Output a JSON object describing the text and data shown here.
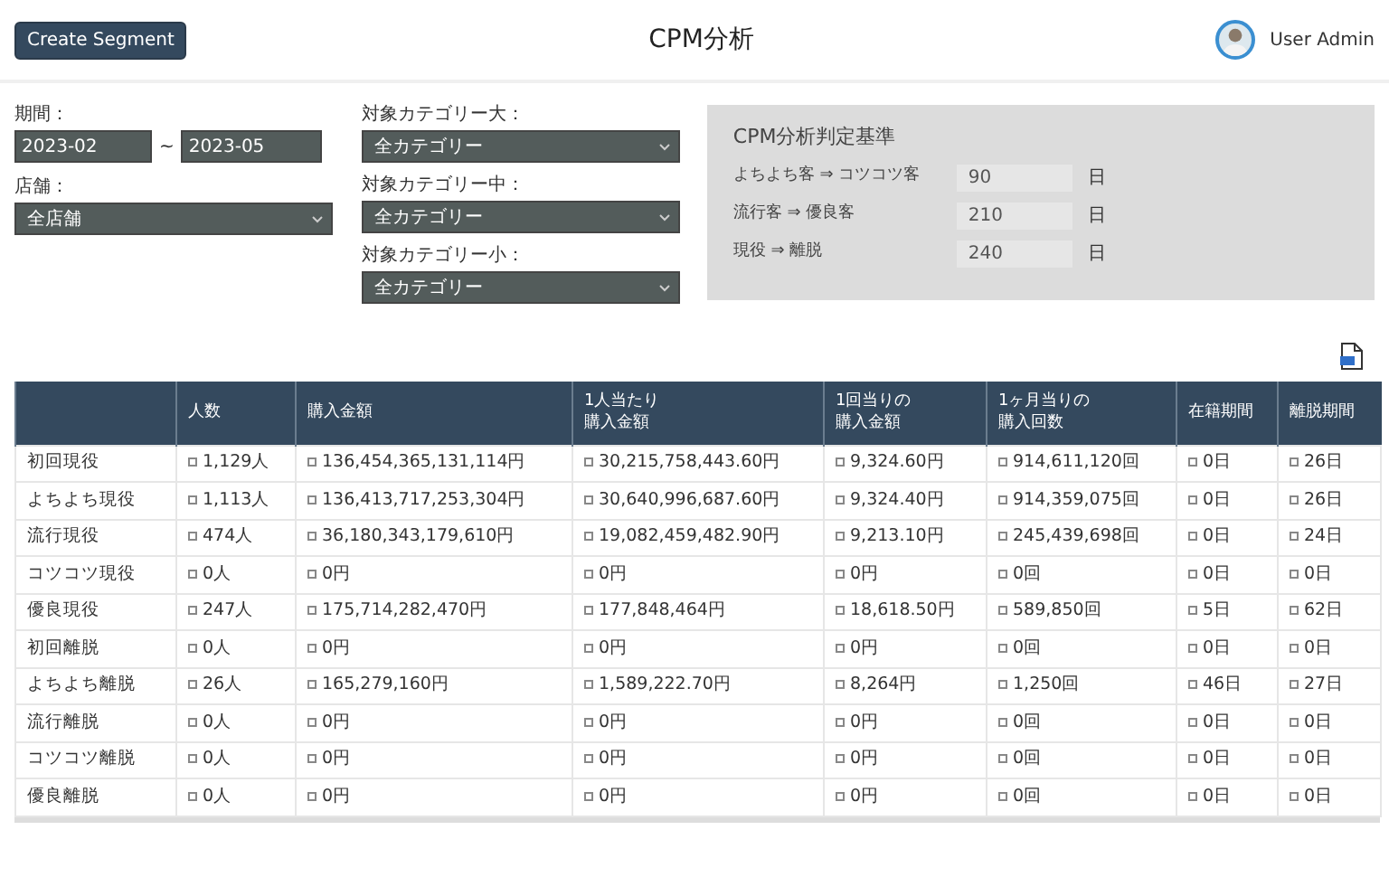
{
  "header": {
    "button": "Create Segment",
    "title": "CPM分析",
    "user": "User Admin"
  },
  "filters": {
    "period": {
      "label": "期間：",
      "from": "2023-02",
      "separator": "~",
      "to": "2023-05"
    },
    "store": {
      "label": "店舗：",
      "value": "全店舗"
    },
    "categories": [
      {
        "label": "対象カテゴリー大：",
        "value": "全カテゴリー"
      },
      {
        "label": "対象カテゴリー中：",
        "value": "全カテゴリー"
      },
      {
        "label": "対象カテゴリー小：",
        "value": "全カテゴリー"
      }
    ]
  },
  "criteria": {
    "title": "CPM分析判定基準",
    "rows": [
      {
        "label": "よちよち客 ⇒ コツコツ客",
        "value": "90",
        "unit": "日"
      },
      {
        "label": "流行客 ⇒ 優良客",
        "value": "210",
        "unit": "日"
      },
      {
        "label": "現役 ⇒ 離脱",
        "value": "240",
        "unit": "日"
      }
    ]
  },
  "table": {
    "columns": [
      "人数",
      "購入金額",
      "1人当たり購入金額",
      "1回当りの購入金額",
      "1ヶ月当りの購入回数",
      "在籍期間",
      "離脱期間"
    ],
    "rows": [
      {
        "label": "初回現役",
        "cells": [
          "1,129人",
          "136,454,365,131,114円",
          "30,215,758,443.60円",
          "9,324.60円",
          "914,611,120回",
          "0日",
          "26日"
        ]
      },
      {
        "label": "よちよち現役",
        "cells": [
          "1,113人",
          "136,413,717,253,304円",
          "30,640,996,687.60円",
          "9,324.40円",
          "914,359,075回",
          "0日",
          "26日"
        ]
      },
      {
        "label": "流行現役",
        "cells": [
          "474人",
          "36,180,343,179,610円",
          "19,082,459,482.90円",
          "9,213.10円",
          "245,439,698回",
          "0日",
          "24日"
        ]
      },
      {
        "label": "コツコツ現役",
        "cells": [
          "0人",
          "0円",
          "0円",
          "0円",
          "0回",
          "0日",
          "0日"
        ]
      },
      {
        "label": "優良現役",
        "cells": [
          "247人",
          "175,714,282,470円",
          "177,848,464円",
          "18,618.50円",
          "589,850回",
          "5日",
          "62日"
        ]
      },
      {
        "label": "初回離脱",
        "cells": [
          "0人",
          "0円",
          "0円",
          "0円",
          "0回",
          "0日",
          "0日"
        ]
      },
      {
        "label": "よちよち離脱",
        "cells": [
          "26人",
          "165,279,160円",
          "1,589,222.70円",
          "8,264円",
          "1,250回",
          "46日",
          "27日"
        ]
      },
      {
        "label": "流行離脱",
        "cells": [
          "0人",
          "0円",
          "0円",
          "0円",
          "0回",
          "0日",
          "0日"
        ]
      },
      {
        "label": "コツコツ離脱",
        "cells": [
          "0人",
          "0円",
          "0円",
          "0円",
          "0回",
          "0日",
          "0日"
        ]
      },
      {
        "label": "優良離脱",
        "cells": [
          "0人",
          "0円",
          "0円",
          "0円",
          "0回",
          "0日",
          "0日"
        ]
      }
    ]
  }
}
